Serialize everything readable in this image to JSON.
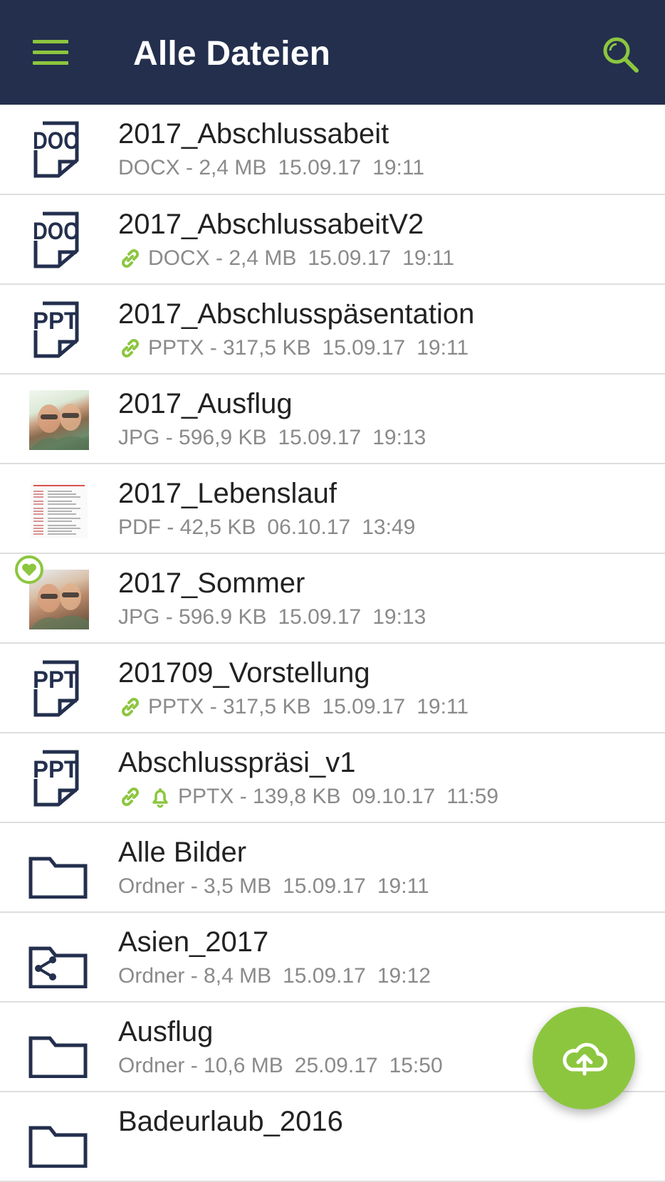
{
  "appbar": {
    "title": "Alle Dateien",
    "menu_icon": "hamburger-menu-icon",
    "search_icon": "search-icon",
    "background": "#232f4d",
    "accent": "#8cc63f"
  },
  "files": [
    {
      "name": "2017_Abschlussabeit",
      "type": "DOCX",
      "size": "2,4 MB",
      "date": "15.09.17",
      "time": "19:11",
      "icon": "doc-file-icon",
      "icon_label": "DOC",
      "shared": false,
      "notify": false,
      "favorite": false
    },
    {
      "name": "2017_AbschlussabeitV2",
      "type": "DOCX",
      "size": "2,4 MB",
      "date": "15.09.17",
      "time": "19:11",
      "icon": "doc-file-icon",
      "icon_label": "DOC",
      "shared": true,
      "notify": false,
      "favorite": false
    },
    {
      "name": "2017_Abschlusspäsentation",
      "type": "PPTX",
      "size": "317,5 KB",
      "date": "15.09.17",
      "time": "19:11",
      "icon": "ppt-file-icon",
      "icon_label": "PPT",
      "shared": true,
      "notify": false,
      "favorite": false
    },
    {
      "name": "2017_Ausflug",
      "type": "JPG",
      "size": "596,9 KB",
      "date": "15.09.17",
      "time": "19:13",
      "icon": "photo-thumbnail",
      "shared": false,
      "notify": false,
      "favorite": false
    },
    {
      "name": "2017_Lebenslauf",
      "type": "PDF",
      "size": "42,5 KB",
      "date": "06.10.17",
      "time": "13:49",
      "icon": "pdf-thumbnail",
      "shared": false,
      "notify": false,
      "favorite": false
    },
    {
      "name": "2017_Sommer",
      "type": "JPG",
      "size": "596.9 KB",
      "date": "15.09.17",
      "time": "19:13",
      "icon": "photo-thumbnail",
      "shared": false,
      "notify": false,
      "favorite": true
    },
    {
      "name": "201709_Vorstellung",
      "type": "PPTX",
      "size": "317,5 KB",
      "date": "15.09.17",
      "time": "19:11",
      "icon": "ppt-file-icon",
      "icon_label": "PPT",
      "shared": true,
      "notify": false,
      "favorite": false
    },
    {
      "name": "Abschlusspräsi_v1",
      "type": "PPTX",
      "size": "139,8 KB",
      "date": "09.10.17",
      "time": "11:59",
      "icon": "ppt-file-icon",
      "icon_label": "PPT",
      "shared": true,
      "notify": true,
      "favorite": false
    },
    {
      "name": "Alle Bilder",
      "type": "Ordner",
      "size": "3,5 MB",
      "date": "15.09.17",
      "time": "19:11",
      "icon": "folder-icon",
      "shared": false,
      "notify": false,
      "favorite": false
    },
    {
      "name": "Asien_2017",
      "type": "Ordner",
      "size": "8,4 MB",
      "date": "15.09.17",
      "time": "19:12",
      "icon": "shared-folder-icon",
      "shared": false,
      "notify": false,
      "favorite": false
    },
    {
      "name": "Ausflug",
      "type": "Ordner",
      "size": "10,6 MB",
      "date": "25.09.17",
      "time": "15:50",
      "icon": "folder-icon",
      "shared": false,
      "notify": false,
      "favorite": false
    },
    {
      "name": "Badeurlaub_2016",
      "type": "",
      "size": "",
      "date": "",
      "time": "",
      "icon": "folder-icon",
      "shared": false,
      "notify": false,
      "favorite": false
    }
  ],
  "fab": {
    "icon": "cloud-upload-icon",
    "color": "#8cc63f"
  }
}
